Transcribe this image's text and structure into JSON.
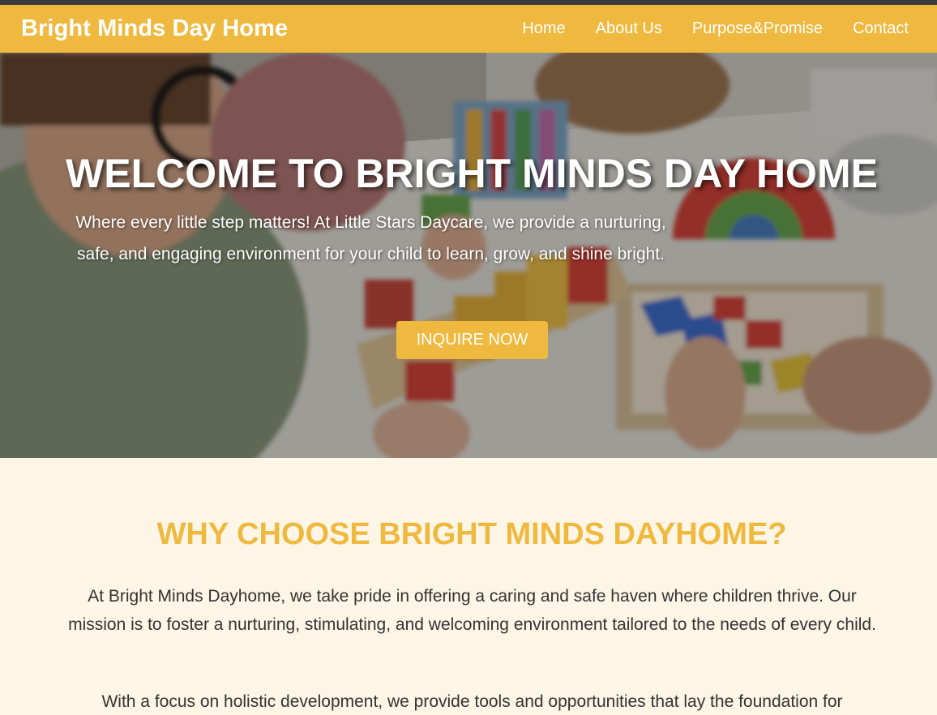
{
  "header": {
    "brand": "Bright Minds Day Home",
    "nav": [
      "Home",
      "About Us",
      "Purpose&Promise",
      "Contact"
    ]
  },
  "hero": {
    "title": "WELCOME TO BRIGHT MINDS DAY HOME",
    "text": "Where every little step matters! At Little Stars Daycare, we provide a nurturing, safe, and engaging environment for your child to learn, grow, and shine bright.",
    "button": "INQUIRE NOW",
    "image": "children-playing-with-blocks-photo"
  },
  "why": {
    "title": "WHY CHOOSE BRIGHT MINDS DAYHOME?",
    "paragraph1": "At Bright Minds Dayhome, we take pride in offering a caring and safe haven where children thrive. Our mission is to foster a nurturing, stimulating, and welcoming environment tailored to the needs of every child.",
    "paragraph2": "With a focus on holistic development, we provide tools and opportunities that lay the foundation for"
  },
  "colors": {
    "accent": "#efb93f",
    "background": "#fdf5e6",
    "text": "#333333"
  }
}
